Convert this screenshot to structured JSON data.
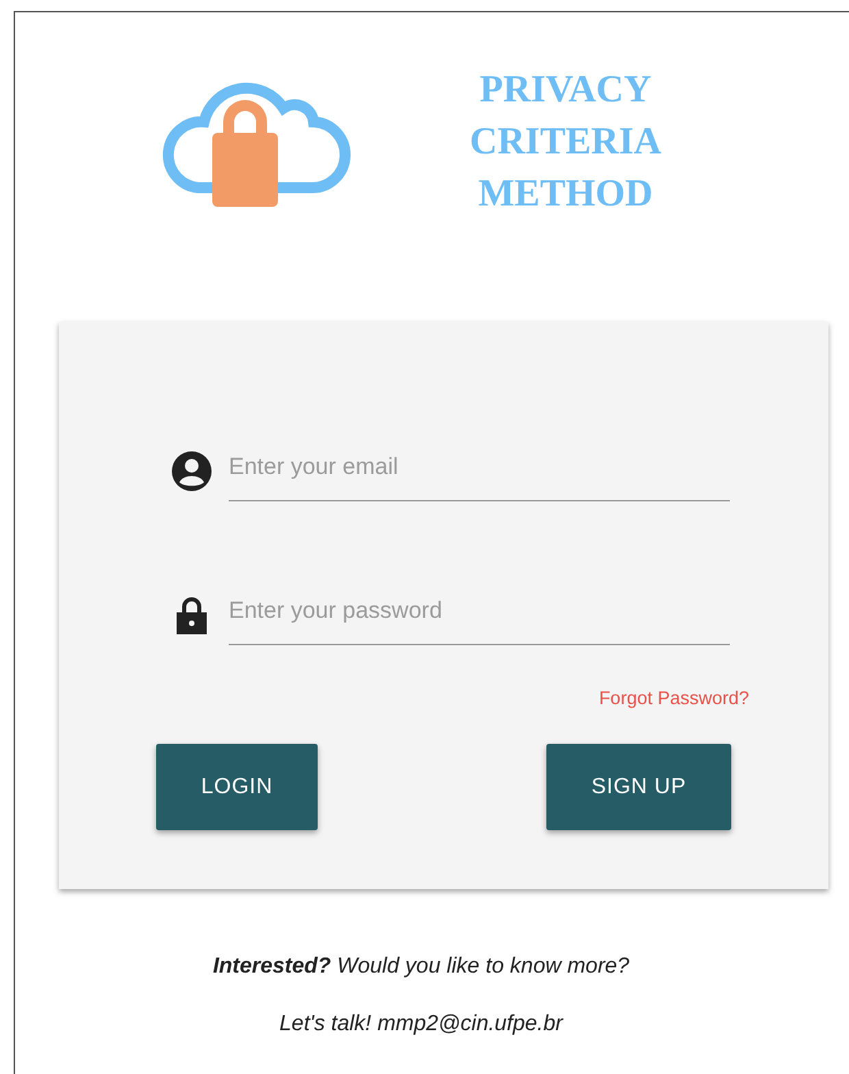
{
  "header": {
    "title": "PRIVACY CRITERIA METHOD"
  },
  "login_form": {
    "fields": [
      {
        "kind": "email",
        "placeholder": "Enter your email"
      },
      {
        "kind": "password",
        "placeholder": "Enter your password"
      }
    ],
    "forgot_link": "Forgot Password?",
    "buttons": [
      "LOGIN",
      "SIGN UP"
    ]
  },
  "footer": {
    "lines": [
      "**Interested?** Would you like to know more?",
      "Let's talk! mmp2@cin.ufpe.br"
    ]
  }
}
